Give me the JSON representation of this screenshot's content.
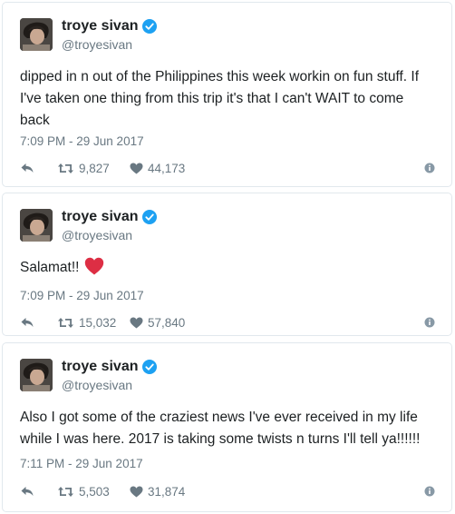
{
  "tweets": [
    {
      "name": "troye sivan",
      "handle": "@troyesivan",
      "text": "dipped in n out of the Philippines this week workin on fun stuff. If I've taken one thing from this trip it's that I can't WAIT to come back",
      "timestamp": "7:09 PM - 29 Jun 2017",
      "retweets": "9,827",
      "likes": "44,173"
    },
    {
      "name": "troye sivan",
      "handle": "@troyesivan",
      "text": "Salamat!!",
      "timestamp": "7:09 PM - 29 Jun 2017",
      "retweets": "15,032",
      "likes": "57,840"
    },
    {
      "name": "troye sivan",
      "handle": "@troyesivan",
      "text": "Also I got some of the craziest news I've ever received in my life while I was here. 2017 is taking some twists n turns I'll tell ya!!!!!!",
      "timestamp": "7:11 PM - 29 Jun 2017",
      "retweets": "5,503",
      "likes": "31,874"
    }
  ],
  "icons": {
    "verified": "verified-badge-icon",
    "reply": "reply-icon",
    "retweet": "retweet-icon",
    "like": "heart-icon",
    "info": "info-icon",
    "emoji": "red-heart-emoji"
  },
  "colors": {
    "verified": "#1da1f2",
    "muted": "#697882",
    "text": "#1c2022",
    "border": "#e1e8ed",
    "emoji_heart": "#dd2e44"
  }
}
